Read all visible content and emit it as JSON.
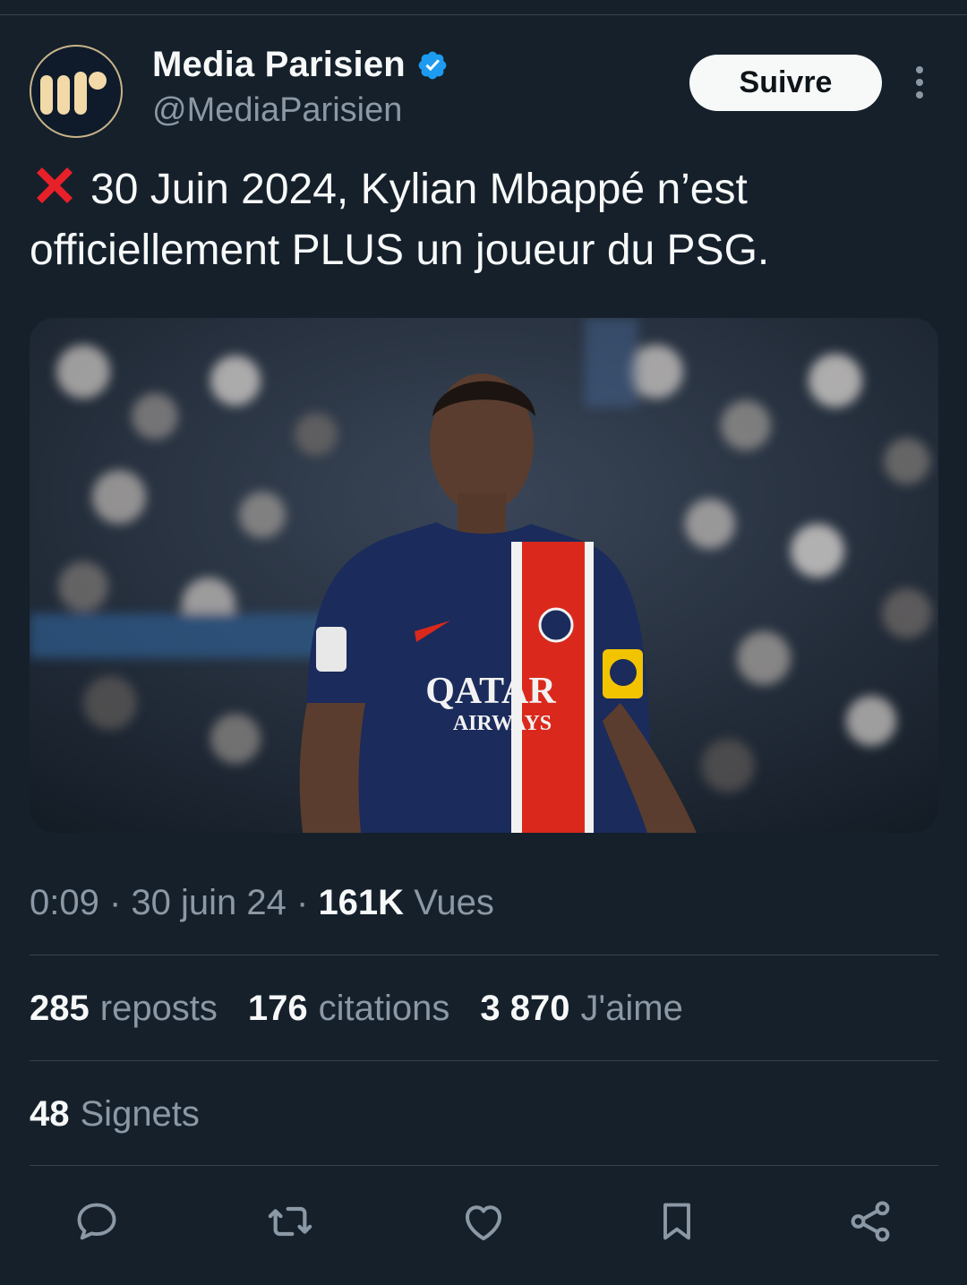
{
  "account": {
    "name": "Media Parisien",
    "handle": "@MediaParisien",
    "verified": true,
    "avatar_icon": "media-parisien-logo",
    "follow_label": "Suivre"
  },
  "tweet": {
    "emoji": "cross-mark-emoji",
    "text_line1": "30 Juin 2024, Kylian Mbappé n’est",
    "text_line2": "officiellement PLUS un joueur du PSG.",
    "image_caption_text": "QATAR AIRWAYS"
  },
  "meta": {
    "time": "0:09",
    "separator": " · ",
    "date": "30 juin 24",
    "views_count": "161K",
    "views_label": "Vues"
  },
  "stats": {
    "reposts_count": "285",
    "reposts_label": "reposts",
    "quotes_count": "176",
    "quotes_label": "citations",
    "likes_count": "3 870",
    "likes_label": "J'aime",
    "bookmarks_count": "48",
    "bookmarks_label": "Signets"
  },
  "actions": [
    "reply-icon",
    "repost-icon",
    "like-icon",
    "bookmark-icon",
    "share-icon"
  ],
  "colors": {
    "background": "#15202b",
    "text": "#f7f9f9",
    "secondary_text": "#8b98a5",
    "divider": "#38444d",
    "verified": "#1d9bf0",
    "psg_red": "#da291c",
    "psg_navy": "#1a2b5c"
  }
}
